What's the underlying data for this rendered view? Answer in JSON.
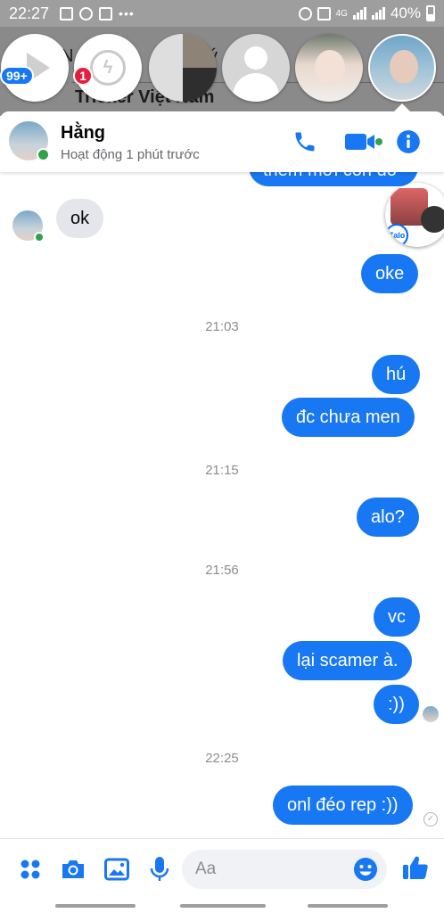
{
  "status_bar": {
    "time": "22:27",
    "battery": "40%",
    "network": "4G"
  },
  "background": {
    "partial_text_top": "N",
    "partial_text_top_right": "ý",
    "partial_text": "Tricker Việt Nam"
  },
  "chat_heads": {
    "badge_first": "99+",
    "badge_second": "1",
    "icons": [
      "play-icon",
      "messenger-icon"
    ]
  },
  "header": {
    "name": "Hằng",
    "status": "Hoạt động 1 phút trước",
    "accent": "#1877f2",
    "online_color": "#31a24c"
  },
  "overlay": {
    "zalo_label": "Zalo"
  },
  "messages": {
    "m_partial": "thêm mới còn đó",
    "m_ok": "ok",
    "m_oke": "oke",
    "t1": "21:03",
    "m_hu": "hú",
    "m_dc": "đc chưa men",
    "t2": "21:15",
    "m_alo": "alo?",
    "t3": "21:56",
    "m_vc": "vc",
    "m_lai": "lại scamer à.",
    "m_smile": ":))",
    "t4": "22:25",
    "m_onl": "onl đéo rep :))"
  },
  "composer": {
    "placeholder": "Aa"
  },
  "colors": {
    "outgoing_bubble": "#1877f2",
    "incoming_bubble": "#e4e6eb",
    "timestamp": "#8a8d91"
  }
}
